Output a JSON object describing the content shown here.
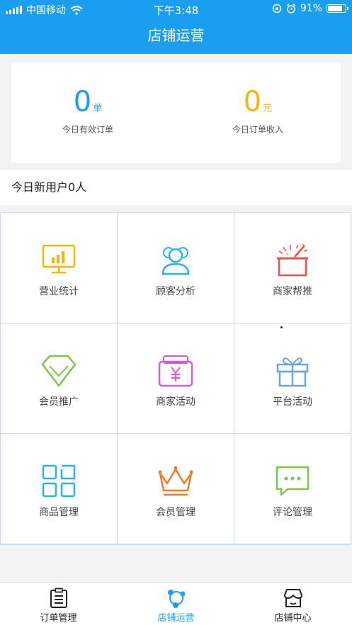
{
  "status_bar": {
    "carrier": "中国移动",
    "time": "下午3:48",
    "battery": "91%",
    "battery_level": 0.91
  },
  "nav": {
    "title": "店铺运营"
  },
  "stats": {
    "orders": {
      "value": "0",
      "unit": "单",
      "label": "今日有效订单"
    },
    "income": {
      "value": "0",
      "unit": "元",
      "label": "今日订单收入"
    }
  },
  "new_users": {
    "text": "今日新用户0人"
  },
  "grid": {
    "items": [
      {
        "label": "营业统计",
        "icon": "chart-monitor-icon",
        "color": "#f2b807"
      },
      {
        "label": "顾客分析",
        "icon": "customers-icon",
        "color": "#27b3ea"
      },
      {
        "label": "商家帮推",
        "icon": "gift-box-icon",
        "color": "#ef4c4c"
      },
      {
        "label": "会员推广",
        "icon": "diamond-icon",
        "color": "#7cc64a"
      },
      {
        "label": "商家活动",
        "icon": "wallet-yen-icon",
        "color": "#d45ad8"
      },
      {
        "label": "平台活动",
        "icon": "present-icon",
        "color": "#6fa3e0"
      },
      {
        "label": "商品管理",
        "icon": "grid-icon",
        "color": "#27b3ea"
      },
      {
        "label": "会员管理",
        "icon": "crown-icon",
        "color": "#ef7a29"
      },
      {
        "label": "评论管理",
        "icon": "comment-icon",
        "color": "#7cc64a"
      }
    ]
  },
  "tabs": [
    {
      "label": "订单管理",
      "icon": "clipboard-icon",
      "active": false
    },
    {
      "label": "店铺运营",
      "icon": "operations-icon",
      "active": true
    },
    {
      "label": "店铺中心",
      "icon": "store-icon",
      "active": false
    }
  ],
  "colors": {
    "primary": "#1a9ef0",
    "accent": "#f2b807"
  }
}
